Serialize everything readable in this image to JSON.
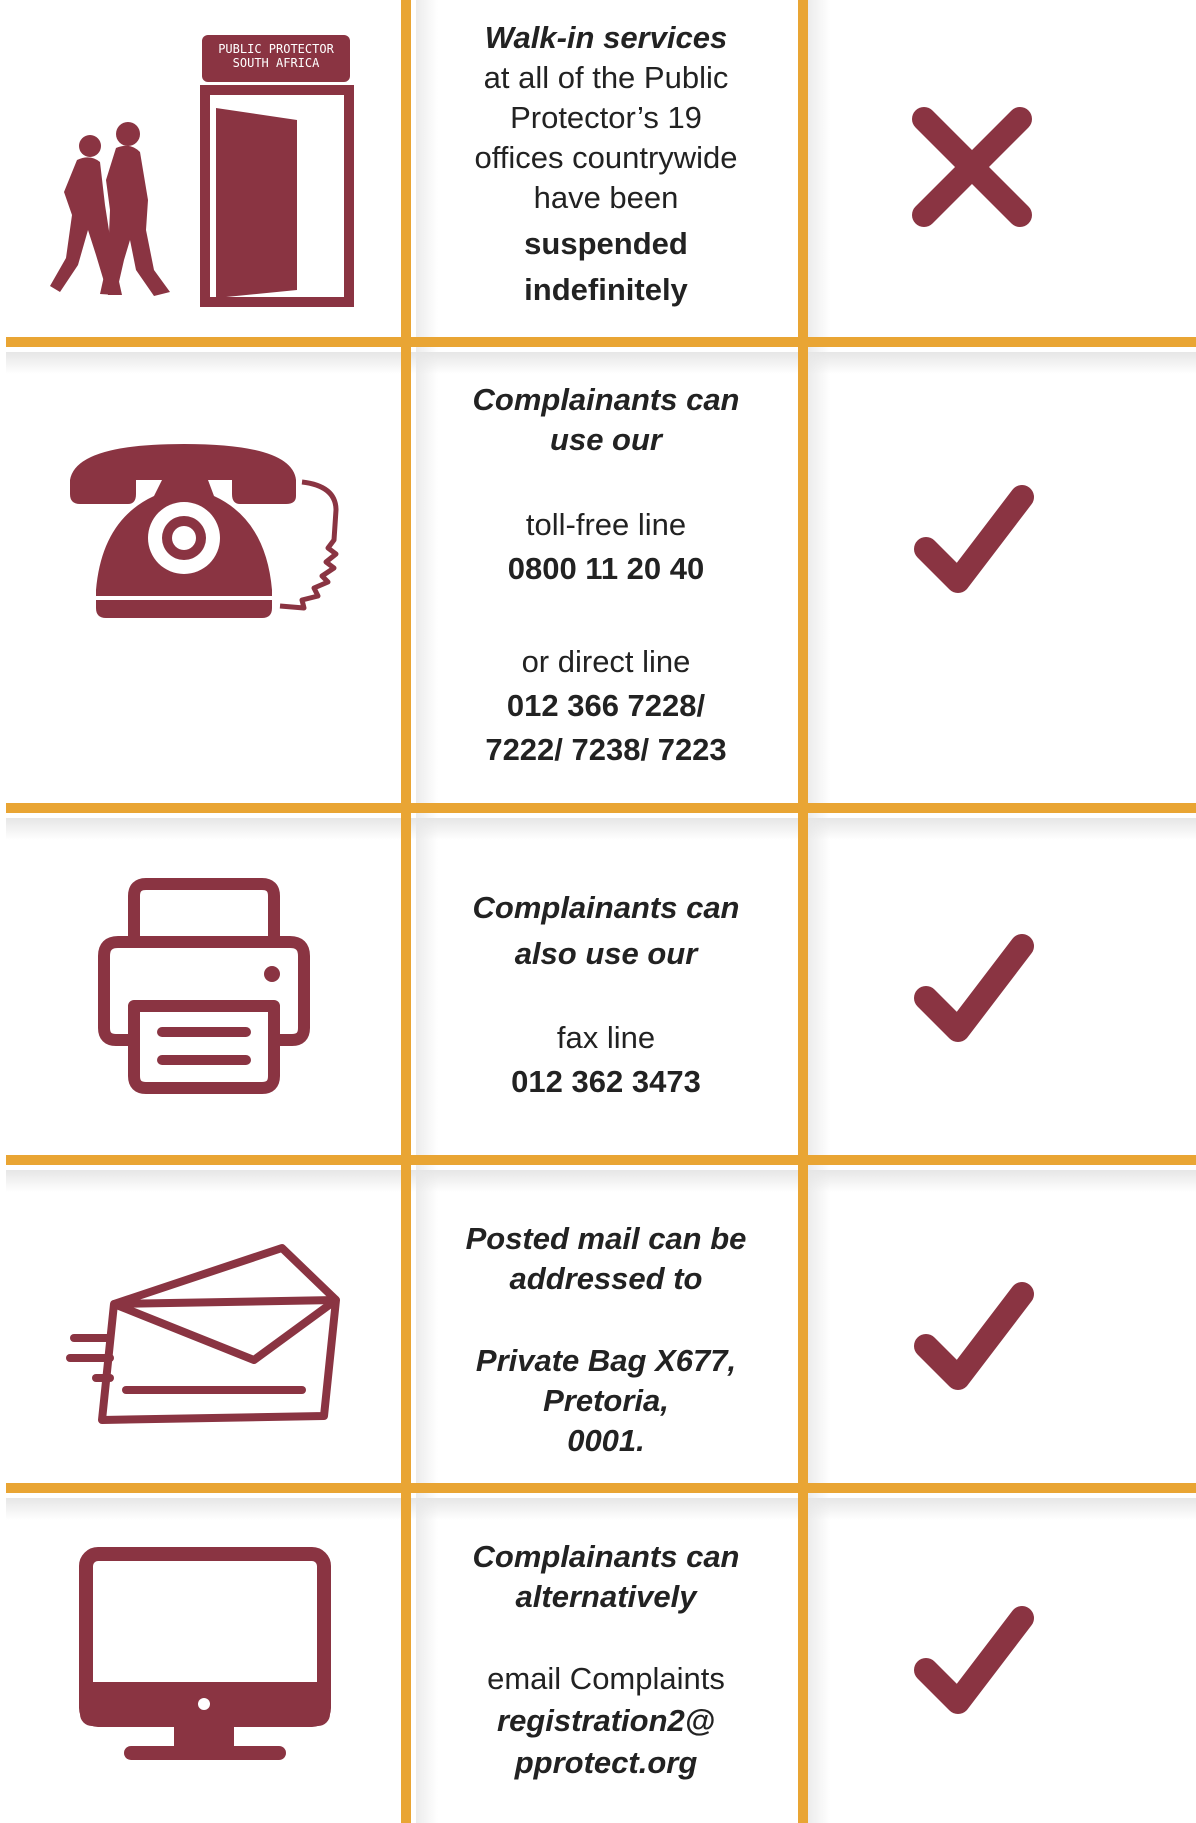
{
  "colors": {
    "accent": "#e9a534",
    "icon": "#8a3442",
    "text": "#222222"
  },
  "rows": [
    {
      "icon": "walk-in-door-icon",
      "sign_lines": [
        "PUBLIC PROTECTOR",
        "SOUTH AFRICA"
      ],
      "lines": [
        "Walk-in services",
        "at all of the Public",
        "Protector’s 19",
        "offices countrywide",
        "have been",
        "suspended",
        "indefinitely"
      ],
      "status": "cross"
    },
    {
      "icon": "telephone-icon",
      "lines": [
        "Complainants can",
        "use our",
        "toll-free line",
        "0800 11 20 40",
        "or direct line",
        "012 366 7228/",
        "7222/ 7238/ 7223"
      ],
      "status": "check"
    },
    {
      "icon": "printer-fax-icon",
      "lines": [
        "Complainants can",
        "also use our",
        "fax line",
        "012 362 3473"
      ],
      "status": "check"
    },
    {
      "icon": "envelope-mail-icon",
      "lines": [
        "Posted mail can be",
        "addressed to",
        "Private Bag X677,",
        "Pretoria,",
        "0001."
      ],
      "status": "check"
    },
    {
      "icon": "computer-monitor-icon",
      "lines": [
        "Complainants can",
        "alternatively",
        "email Complaints",
        "registration2@",
        "pprotect.org"
      ],
      "status": "check"
    }
  ]
}
